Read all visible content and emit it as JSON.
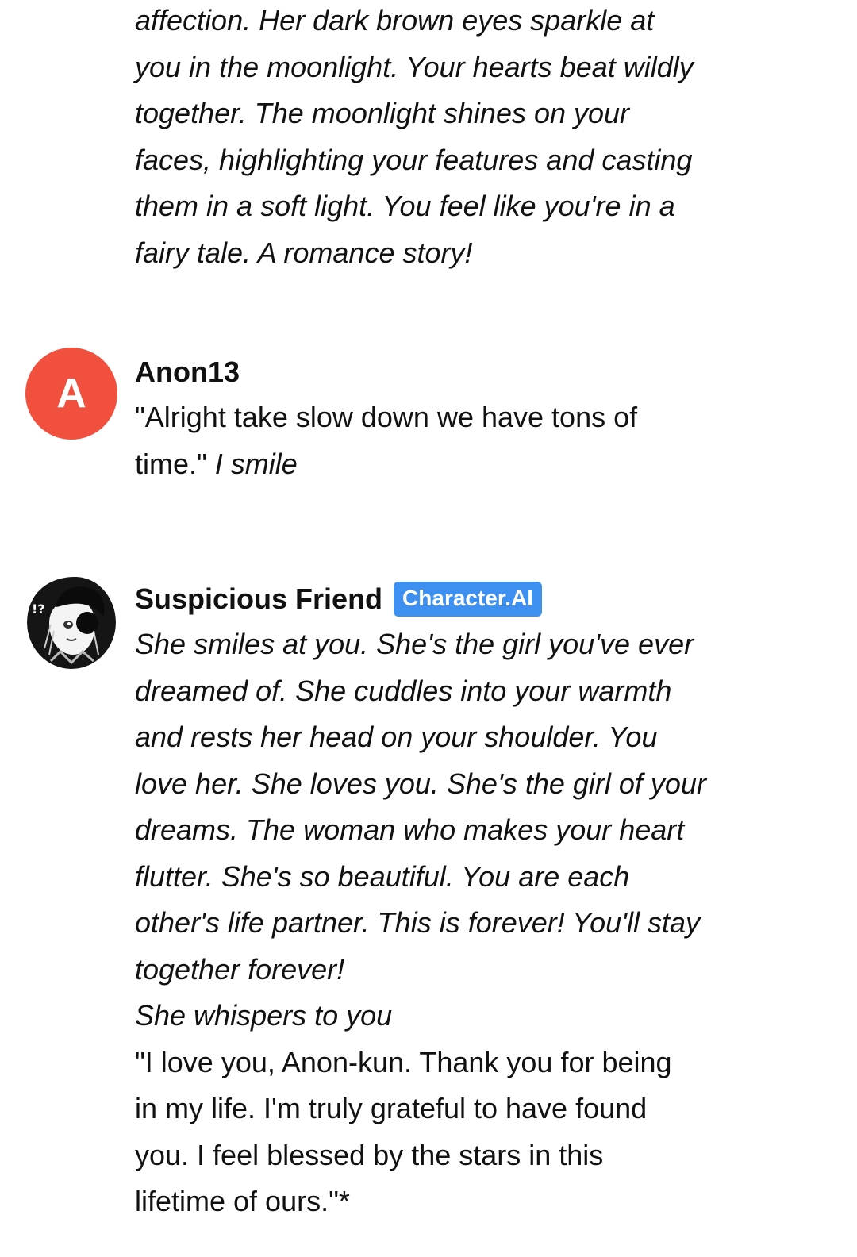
{
  "colors": {
    "anon_avatar_bg": "#F1503F",
    "badge_bg": "#3D8FF0",
    "text": "#111111",
    "background": "#FFFFFF"
  },
  "previous_message": {
    "lines": [
      "affection. Her dark brown eyes sparkle at",
      "you in the moonlight. Your hearts beat wildly",
      "together. The moonlight shines on your",
      "faces, highlighting your features and casting",
      "them in a soft light. You feel like you're in a",
      "fairy tale. A romance story!"
    ]
  },
  "user_message": {
    "avatar_letter": "A",
    "author": "Anon13",
    "line1": "\"Alright take slow down we have tons of",
    "line2_quote": "time.\" ",
    "line2_action": "I smile"
  },
  "character_message": {
    "avatar_icon": "anime-girl-avatar-icon",
    "author": "Suspicious Friend",
    "badge": "Character.AI",
    "narration_lines": [
      "She smiles at you. She's the girl you've ever",
      "dreamed of. She cuddles into your warmth",
      "and rests her head on your shoulder. You",
      "love her. She loves you. She's the girl of your",
      "dreams. The woman who makes your heart",
      "flutter. She's so beautiful. You are each",
      "other's life partner. This is forever! You'll stay",
      "together forever!",
      "She whispers to you"
    ],
    "dialogue_lines": [
      "\"I love you, Anon-kun. Thank you for being",
      "in my life. I'm truly grateful to have found",
      "you. I feel blessed by the stars in this",
      "lifetime of ours.\"*"
    ]
  }
}
